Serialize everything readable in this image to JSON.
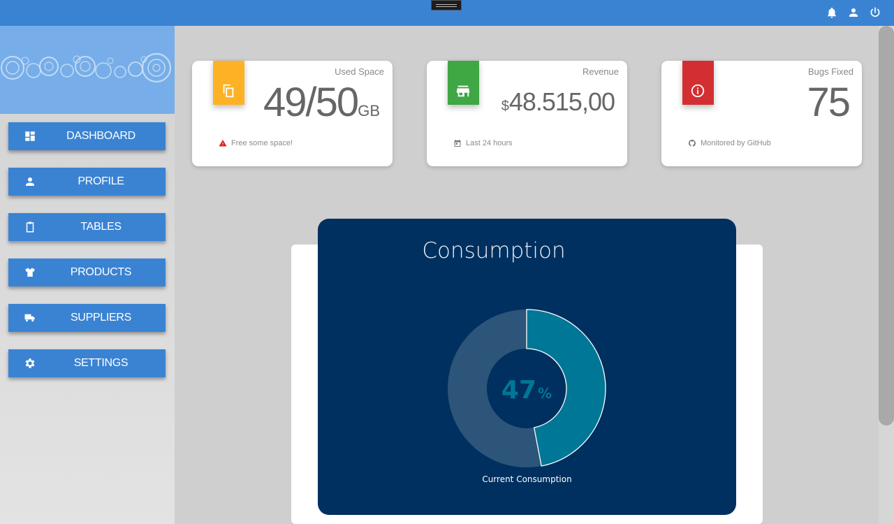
{
  "topbar": {
    "icons": [
      "bell-icon",
      "user-icon",
      "power-icon"
    ]
  },
  "sidebar": {
    "items": [
      {
        "label": "DASHBOARD",
        "icon": "dashboard-icon"
      },
      {
        "label": "PROFILE",
        "icon": "person-icon"
      },
      {
        "label": "TABLES",
        "icon": "clipboard-icon"
      },
      {
        "label": "PRODUCTS",
        "icon": "shirt-icon"
      },
      {
        "label": "SUPPLIERS",
        "icon": "truck-icon"
      },
      {
        "label": "SETTINGS",
        "icon": "gear-icon"
      }
    ]
  },
  "cards": [
    {
      "title": "Used Space",
      "value": "49/50",
      "unit": "GB",
      "footer": "Free some space!",
      "color": "#fdb225",
      "icon": "copy-icon",
      "footer_icon": "warning-icon"
    },
    {
      "title": "Revenue",
      "prefix": "$",
      "value": "48.515,00",
      "footer": "Last 24 hours",
      "color": "#3fa744",
      "icon": "store-icon",
      "footer_icon": "calendar-icon"
    },
    {
      "title": "Bugs Fixed",
      "value": "75",
      "footer": "Monitored by GitHub",
      "color": "#d32f33",
      "icon": "info-icon",
      "footer_icon": "github-icon"
    }
  ],
  "colors": {
    "topbar": "#3a83d3",
    "chart_bg": "#00305f",
    "chart_fill": "#007797",
    "chart_track": "#2d5479"
  },
  "consumption": {
    "title": "Consumption",
    "percent_value": "47",
    "percent_sign": "%",
    "caption": "Current Consumption"
  },
  "chart_data": {
    "type": "pie",
    "title": "Consumption",
    "categories": [
      "Current Consumption",
      ""
    ],
    "values": [
      47,
      53
    ]
  }
}
